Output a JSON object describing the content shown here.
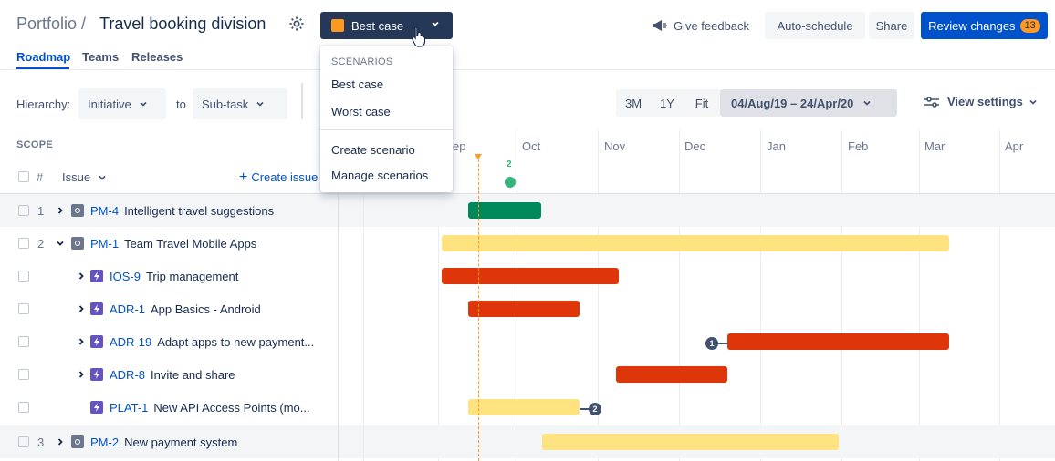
{
  "header": {
    "portfolio_label": "Portfolio /",
    "plan_name": "Travel booking division",
    "scenario": {
      "label": "Best case",
      "color": "#FF991F"
    },
    "feedback_label": "Give feedback",
    "autoschedule_label": "Auto-schedule",
    "share_label": "Share",
    "review_label": "Review changes",
    "review_count": "13"
  },
  "tabs": [
    {
      "label": "Roadmap",
      "active": true
    },
    {
      "label": "Teams",
      "active": false
    },
    {
      "label": "Releases",
      "active": false
    }
  ],
  "toolbar": {
    "hierarchy_label": "Hierarchy:",
    "hierarchy_from": "Initiative",
    "to_label": "to",
    "hierarchy_to": "Sub-task",
    "zoom_options": [
      "3M",
      "1Y",
      "Fit"
    ],
    "date_range": "04/Aug/19 – 24/Apr/20",
    "view_settings_label": "View settings"
  },
  "scope": {
    "heading": "SCOPE",
    "hash_label": "#",
    "issue_label": "Issue",
    "create_issue_label": "Create issue"
  },
  "timeline": {
    "months": [
      "ep",
      "Oct",
      "Nov",
      "Dec",
      "Jan",
      "Feb",
      "Mar",
      "Apr"
    ],
    "release_count": "2"
  },
  "rows": [
    {
      "num": "1",
      "key": "PM-4",
      "title": "Intelligent travel suggestions",
      "type": "initiative",
      "expand": "right",
      "shaded": true
    },
    {
      "num": "2",
      "key": "PM-1",
      "title": "Team Travel Mobile Apps",
      "type": "initiative",
      "expand": "down",
      "shaded": false
    },
    {
      "num": "",
      "key": "IOS-9",
      "title": "Trip management",
      "type": "epic",
      "expand": "right",
      "shaded": false
    },
    {
      "num": "",
      "key": "ADR-1",
      "title": "App Basics - Android",
      "type": "epic",
      "expand": "right",
      "shaded": false
    },
    {
      "num": "",
      "key": "ADR-19",
      "title": "Adapt apps to new payment...",
      "type": "epic",
      "expand": "right",
      "shaded": false
    },
    {
      "num": "",
      "key": "ADR-8",
      "title": "Invite and share",
      "type": "epic",
      "expand": "right",
      "shaded": false
    },
    {
      "num": "",
      "key": "PLAT-1",
      "title": "New API Access Points (mo...",
      "type": "epic",
      "expand": "none",
      "shaded": false
    },
    {
      "num": "3",
      "key": "PM-2",
      "title": "New payment system",
      "type": "initiative",
      "expand": "right",
      "shaded": true
    }
  ],
  "dependencies": {
    "adr19_count": "1",
    "plat1_count": "2"
  },
  "dropdown": {
    "heading": "SCENARIOS",
    "scenarios": [
      "Best case",
      "Worst case"
    ],
    "actions": [
      "Create scenario",
      "Manage scenarios"
    ]
  },
  "colors": {
    "accent": "#0052CC",
    "scenario_button": "#253858",
    "bar_green": "#00875A",
    "bar_yellow": "#FFE380",
    "bar_red": "#DE350B",
    "today": "#FF991F"
  }
}
